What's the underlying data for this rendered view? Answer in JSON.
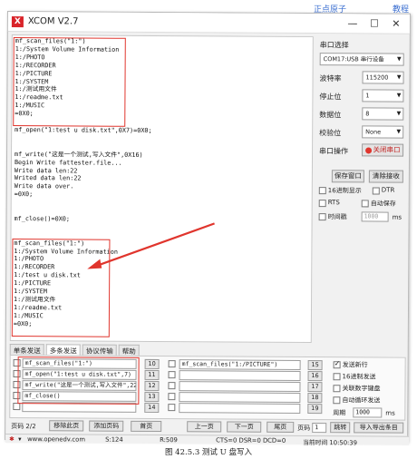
{
  "header": {
    "left_brand": "正点原子",
    "right_brand": "教程"
  },
  "window": {
    "title": "XCOM V2.7",
    "logo": "X",
    "minimize": "—",
    "maximize": "☐",
    "close": "✕"
  },
  "output_lines": [
    "mf_scan_files(\"1:\")",
    "1:/System Volume Information",
    "1:/PHOTO",
    "1:/RECORDER",
    "1:/PICTURE",
    "1:/SYSTEM",
    "1:/测试用文件",
    "1:/readme.txt",
    "1:/MUSIC",
    "=0X0;",
    "",
    "mf_open(\"1:test u disk.txt\",0X7)=0X0;",
    "",
    "",
    "mf_write(\"这是一个测试,写入文件\",0X16)",
    "Begin Write fattester.file...",
    "Write data len:22",
    "Writed data len:22",
    "Write data over.",
    "=0X0;",
    "",
    "",
    "mf_close()=0X0;",
    "",
    "",
    "mf_scan_files(\"1:\")",
    "1:/System Volume Information",
    "1:/PHOTO",
    "1:/RECORDER",
    "1:/test u disk.txt",
    "1:/PICTURE",
    "1:/SYSTEM",
    "1:/测试用文件",
    "1:/readme.txt",
    "1:/MUSIC",
    "=0X0;"
  ],
  "panel": {
    "port_label": "串口选择",
    "port_value": "COM17:USB 串行设备",
    "baud_label": "波特率",
    "baud_value": "115200",
    "stopbits_label": "停止位",
    "stopbits_value": "1",
    "databits_label": "数据位",
    "databits_value": "8",
    "parity_label": "校验位",
    "parity_value": "None",
    "port_op_label": "串口操作",
    "close_port_label": "关闭串口",
    "save_window_label": "保存窗口",
    "clear_recv_label": "清除接收",
    "hex_display_label": "16进制显示",
    "dtr_label": "DTR",
    "rts_label": "RTS",
    "autosave_label": "自动保存",
    "timestamp_label": "时间戳",
    "timestamp_value": "1000",
    "timestamp_unit": "ms"
  },
  "tabs": [
    "单条发送",
    "多条发送",
    "协议传输",
    "帮助"
  ],
  "multi_send": {
    "left_fields": [
      "mf_scan_files(\"1:\")",
      "mf_open(\"1:test u disk.txt\",7)",
      "mf_write(\"这是一个测试,写入文件\",22)",
      "mf_close()",
      ""
    ],
    "left_numbers": [
      "10",
      "11",
      "12",
      "13",
      "14"
    ],
    "right_fields": [
      "mf_scan_files(\"1:/PICTURE\")",
      "",
      "",
      "",
      ""
    ],
    "right_numbers": [
      "15",
      "16",
      "17",
      "18",
      "19"
    ],
    "option_send_newline": "发送新行",
    "option_hex_send": "16进制发送",
    "option_keyword_kbd": "关联数字键盘",
    "option_auto_loop": "自动循环发送",
    "period_label": "周期",
    "period_value": "1000",
    "period_unit": "ms"
  },
  "pager": {
    "page_label": "页码 2/2",
    "remove_page": "移除此页",
    "add_page": "添加页码",
    "first_page": "首页",
    "prev_page": "上一页",
    "next_page": "下一页",
    "last_page": "尾页",
    "page_jump_label": "页码",
    "page_jump_value": "1",
    "jump_button": "跳转",
    "import_export": "导入导出条目"
  },
  "status": {
    "url": "www.openedv.com",
    "sent": "S:124",
    "received": "R:509",
    "signals": "CTS=0 DSR=0 DCD=0",
    "time": "当前时间 10:50:39"
  },
  "caption": "图 42.5.3  测试 U 盘写入"
}
